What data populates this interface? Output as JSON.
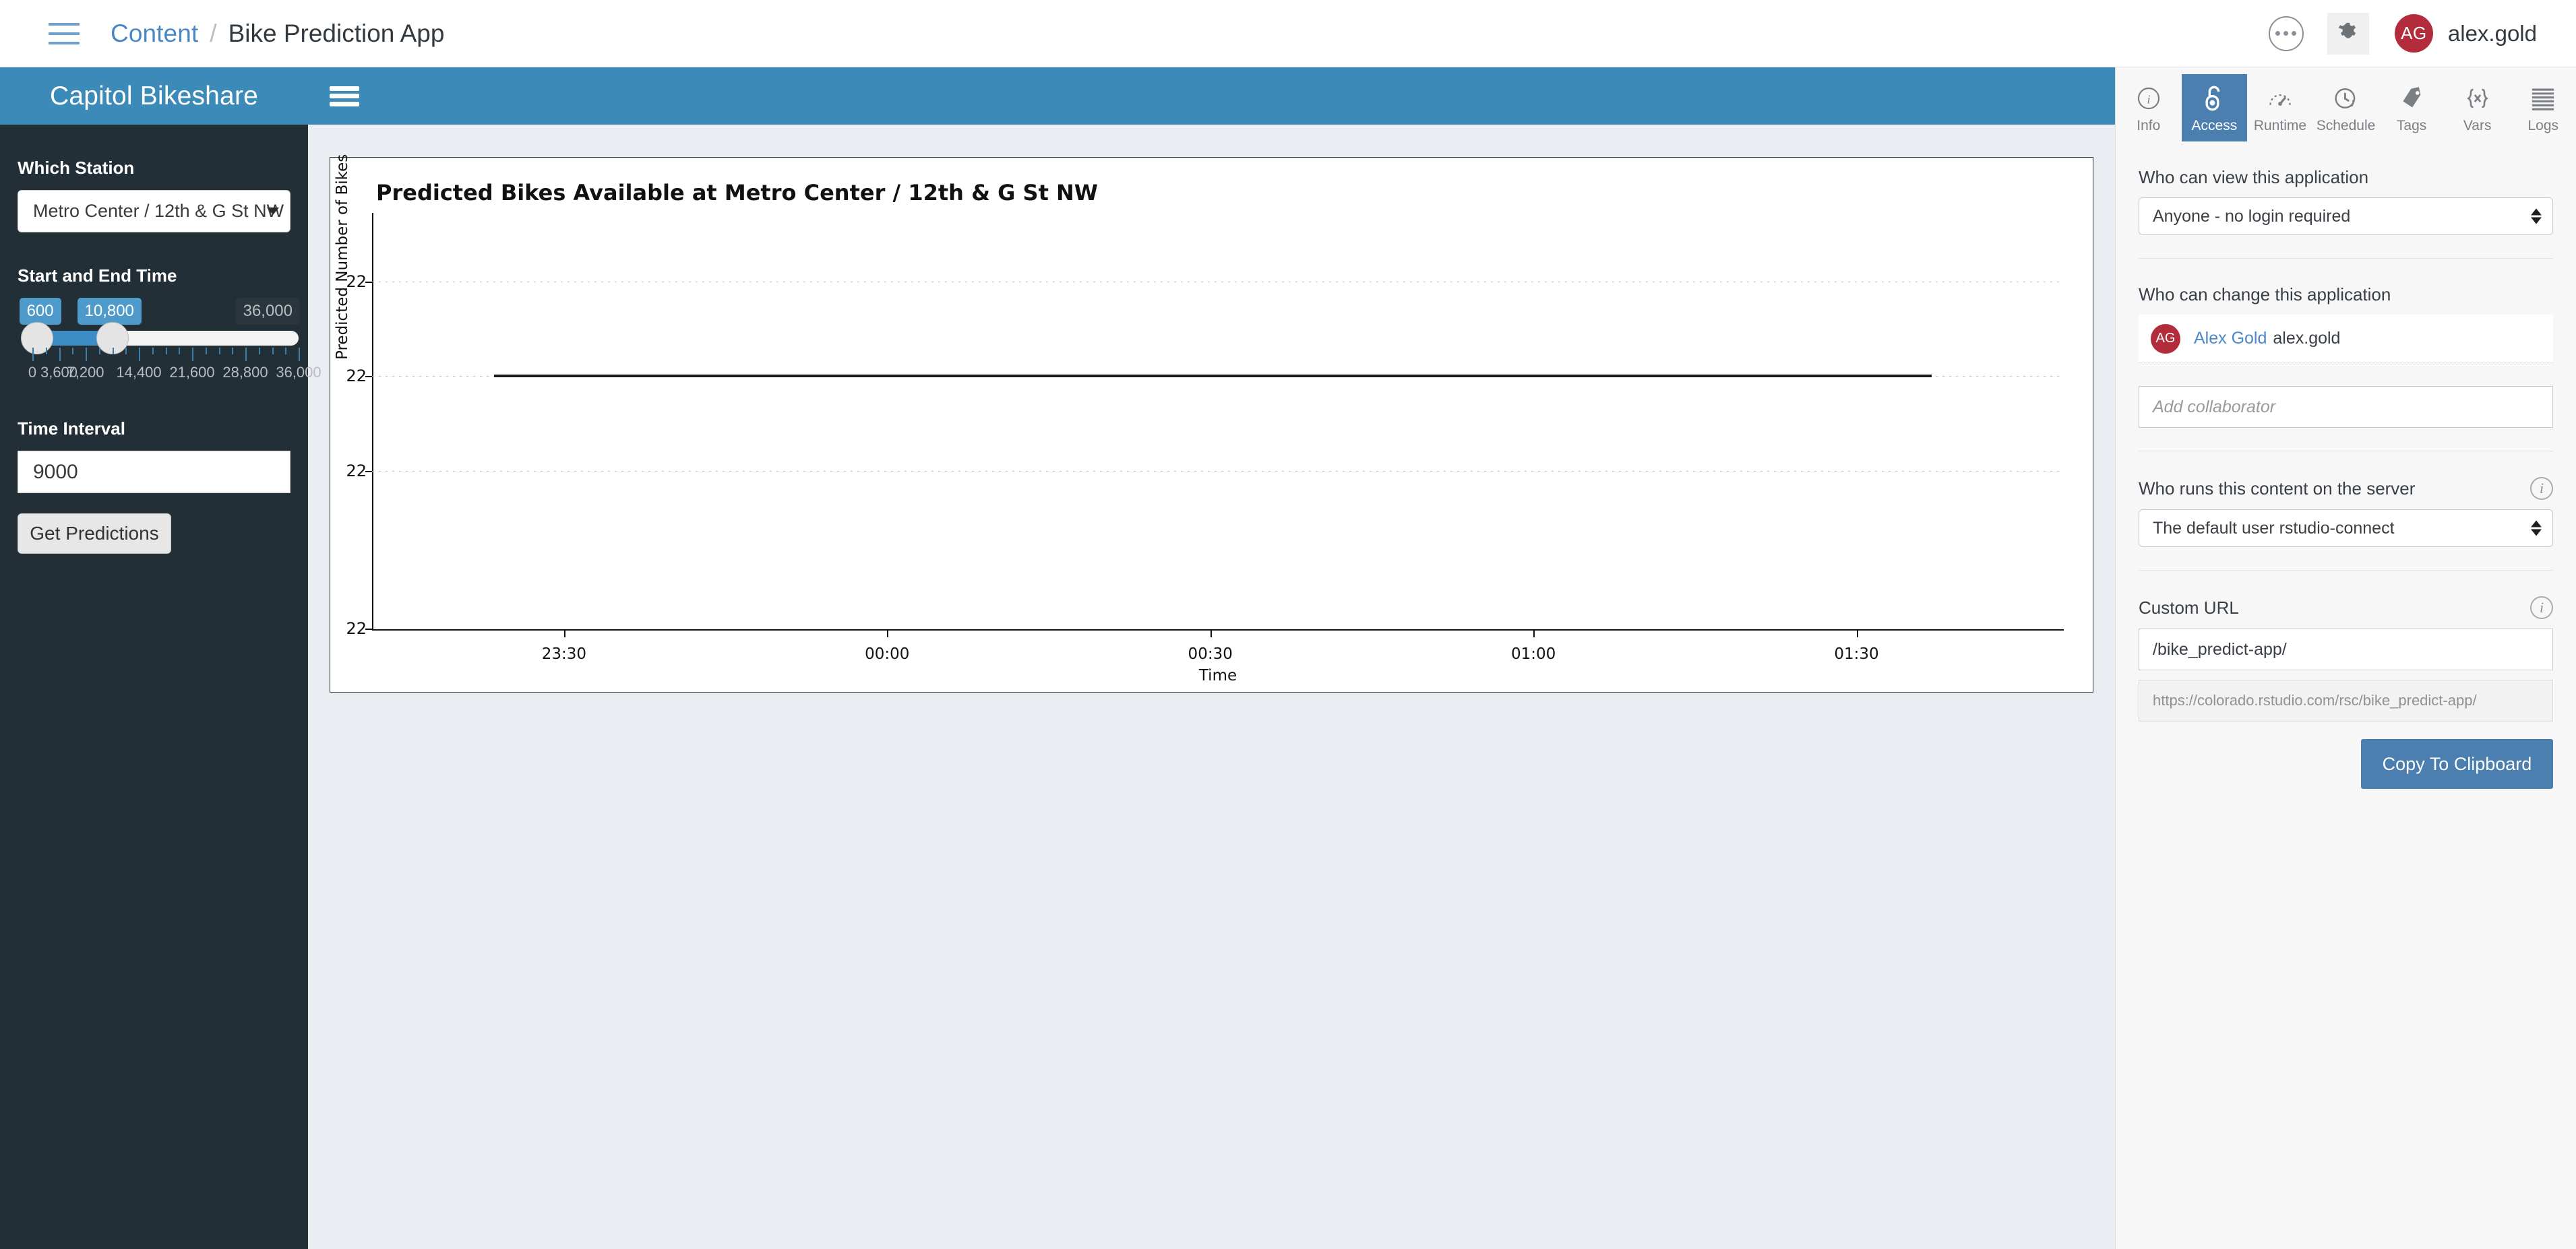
{
  "topbar": {
    "menu_icon": "hamburger-icon",
    "breadcrumb_root": "Content",
    "breadcrumb_sep": "/",
    "breadcrumb_current": "Bike Prediction App",
    "more_icon": "more-options-icon",
    "settings_icon": "gear-icon",
    "avatar_initials": "AG",
    "username": "alex.gold"
  },
  "app": {
    "brand": "Capitol Bikeshare",
    "menu_icon": "hamburger-icon",
    "sidebar": {
      "station_label": "Which Station",
      "station_value": "Metro Center / 12th & G St NW",
      "time_label": "Start and End Time",
      "slider": {
        "low_value": "600",
        "high_value": "10,800",
        "max_badge": "36,000",
        "min": 0,
        "max": 36000,
        "low": 600,
        "high": 10800,
        "tick_labels": [
          "0",
          "3,600",
          "7,200",
          "14,400",
          "21,600",
          "28,800",
          "36,000"
        ],
        "tick_values": [
          0,
          3600,
          7200,
          14400,
          21600,
          28800,
          36000
        ]
      },
      "interval_label": "Time Interval",
      "interval_value": "9000",
      "submit_label": "Get Predictions"
    }
  },
  "chart_data": {
    "type": "line",
    "title": "Predicted Bikes Available at Metro Center / 12th & G St NW",
    "xlabel": "Time",
    "ylabel": "Predicted Number of Bikes",
    "x_tick_labels": [
      "23:30",
      "00:00",
      "00:30",
      "01:00",
      "01:30"
    ],
    "y_tick_labels": [
      "22",
      "22",
      "22",
      "22"
    ],
    "x": [
      "23:30",
      "00:00",
      "00:30",
      "01:00"
    ],
    "values": [
      22,
      22,
      22,
      22
    ],
    "ylim": [
      22,
      22
    ],
    "grid": true,
    "legend": "none",
    "note": "Flat constant series at 22 bikes; y-axis collapsed so all four ticks read 22."
  },
  "rightpanel": {
    "tabs": [
      {
        "label": "Info",
        "icon": "info-circle-icon",
        "active": false
      },
      {
        "label": "Access",
        "icon": "unlocked-padlock-icon",
        "active": true
      },
      {
        "label": "Runtime",
        "icon": "gauge-icon",
        "active": false
      },
      {
        "label": "Schedule",
        "icon": "clock-arrow-icon",
        "active": false
      },
      {
        "label": "Tags",
        "icon": "tag-icon",
        "active": false
      },
      {
        "label": "Vars",
        "icon": "braces-x-icon",
        "active": false
      },
      {
        "label": "Logs",
        "icon": "lines-log-icon",
        "active": false
      }
    ],
    "view_label": "Who can view this application",
    "view_value": "Anyone - no login required",
    "change_label": "Who can change this application",
    "collaborator": {
      "initials": "AG",
      "name": "Alex Gold",
      "username": "alex.gold"
    },
    "add_collaborator_placeholder": "Add collaborator",
    "runs_label": "Who runs this content on the server",
    "runs_value": "The default user rstudio-connect",
    "custom_url_label": "Custom URL",
    "custom_url_value": "/bike_predict-app/",
    "full_url_value": "https://colorado.rstudio.com/rsc/bike_predict-app/",
    "copy_label": "Copy To Clipboard",
    "info_icon": "info-circle-icon"
  },
  "colors": {
    "brand_blue": "#3b8ab8",
    "accent_blue": "#4a7fb0",
    "sidebar_dark": "#222f36",
    "avatar_red": "#b32c3c",
    "page_bg": "#eaedf2"
  }
}
